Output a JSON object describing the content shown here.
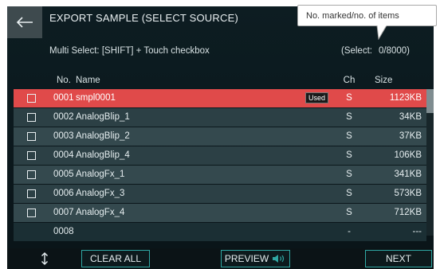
{
  "header": {
    "title": "EXPORT SAMPLE (SELECT SOURCE)",
    "subtitle": "Multi Select: [SHIFT] + Touch checkbox",
    "select_label": "(Select:",
    "select_value": "0/8000)"
  },
  "callout": {
    "text": "No. marked/no. of items"
  },
  "table": {
    "headers": {
      "no": "No.",
      "name": "Name",
      "ch": "Ch",
      "size": "Size"
    },
    "rows": [
      {
        "no": "0001",
        "name": "smpl0001",
        "badge": "Used",
        "ch": "S",
        "size": "1123KB"
      },
      {
        "no": "0002",
        "name": "AnalogBlip_1",
        "badge": "",
        "ch": "S",
        "size": "34KB"
      },
      {
        "no": "0003",
        "name": "AnalogBlip_2",
        "badge": "",
        "ch": "S",
        "size": "37KB"
      },
      {
        "no": "0004",
        "name": "AnalogBlip_4",
        "badge": "",
        "ch": "S",
        "size": "106KB"
      },
      {
        "no": "0005",
        "name": "AnalogFx_1",
        "badge": "",
        "ch": "S",
        "size": "341KB"
      },
      {
        "no": "0006",
        "name": "AnalogFx_3",
        "badge": "",
        "ch": "S",
        "size": "573KB"
      },
      {
        "no": "0007",
        "name": "AnalogFx_4",
        "badge": "",
        "ch": "S",
        "size": "712KB"
      },
      {
        "no": "0008",
        "name": "",
        "badge": "",
        "ch": "-",
        "size": "---"
      }
    ]
  },
  "footer": {
    "clear_all": "CLEAR ALL",
    "preview": "PREVIEW",
    "next": "NEXT"
  },
  "colors": {
    "accent": "#2fa7a3",
    "active_row": "#e04a4a",
    "row": "#34494e",
    "background": "#0d1d22"
  },
  "icons": {
    "back": "arrow-left-icon",
    "sort": "up-down-arrow-icon",
    "speaker": "speaker-icon"
  }
}
